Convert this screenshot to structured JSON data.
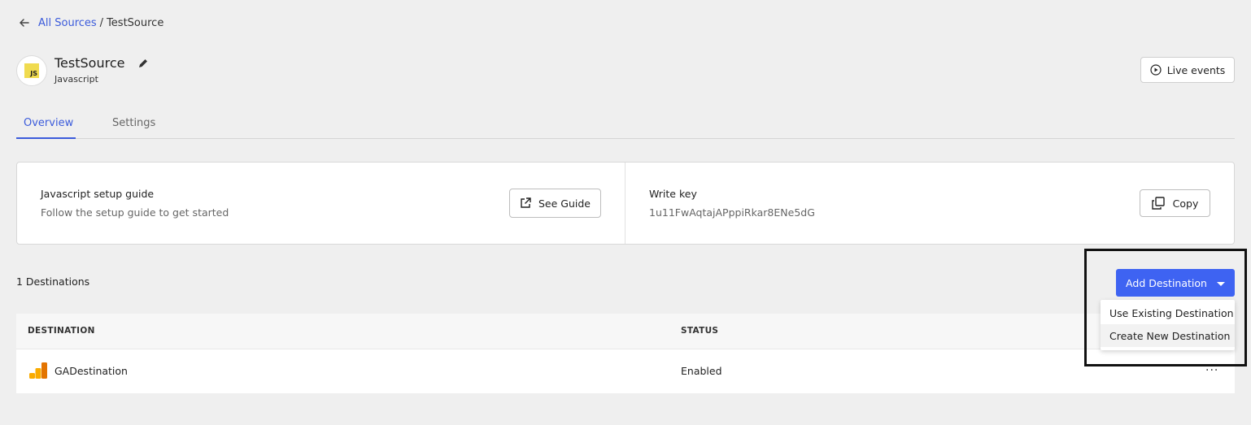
{
  "breadcrumb": {
    "parent": "All Sources",
    "separator": "/",
    "current": "TestSource"
  },
  "source": {
    "name": "TestSource",
    "type": "Javascript",
    "logo_text": "JS",
    "logo_color": "#f0db4f"
  },
  "header": {
    "live_events_label": "Live events"
  },
  "tabs": [
    {
      "label": "Overview",
      "active": true
    },
    {
      "label": "Settings",
      "active": false
    }
  ],
  "setup": {
    "title": "Javascript setup guide",
    "subtitle": "Follow the setup guide to get started",
    "button_label": "See Guide"
  },
  "write_key": {
    "title": "Write key",
    "value": "1u11FwAqtajAPppiRkar8ENe5dG",
    "copy_label": "Copy"
  },
  "destinations": {
    "count_label": "1 Destinations",
    "add_button_label": "Add Destination",
    "dropdown": [
      "Use Existing Destination",
      "Create New Destination"
    ],
    "columns": [
      "DESTINATION",
      "STATUS"
    ],
    "rows": [
      {
        "name": "GADestination",
        "status": "Enabled",
        "more": "..."
      }
    ]
  },
  "colors": {
    "accent": "#3e63f2",
    "link": "#3b5bdb",
    "background": "#efefef"
  }
}
